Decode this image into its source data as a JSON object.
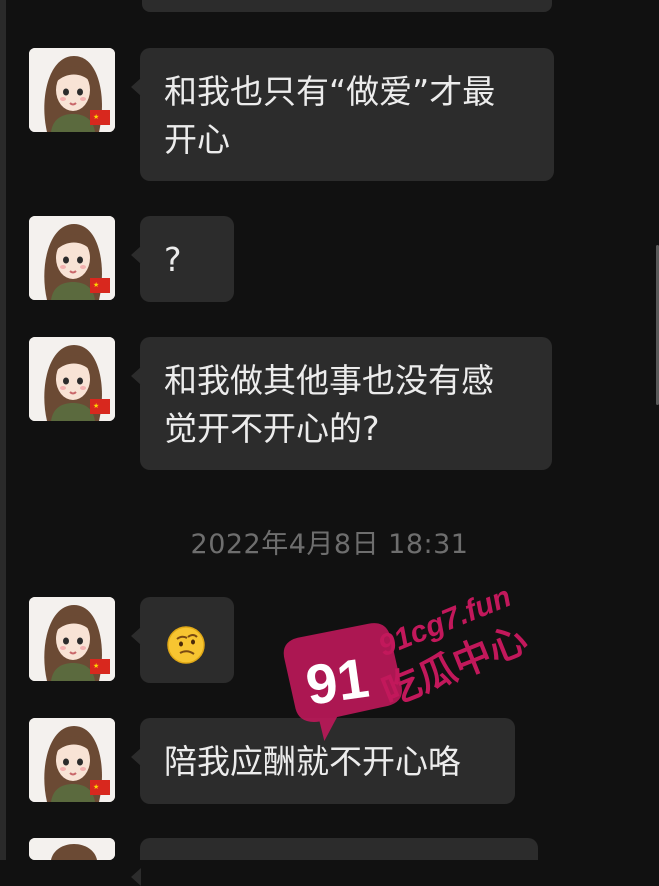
{
  "messages": [
    {
      "text": "和我也只有“做爱”才最开心",
      "line1": "和我也只有“做爱”才最",
      "line2": "开心"
    },
    {
      "text": "?"
    },
    {
      "text": "和我做其他事也没有感觉开不开心的?",
      "line1": "和我做其他事也没有感",
      "line2": "觉开不开心的?"
    },
    {
      "emoji": "confused-face-emoji"
    },
    {
      "text": "陪我应酬就不开心咯"
    }
  ],
  "timestamp": "2022年4月8日 18:31",
  "watermark": {
    "number": "91",
    "site": "91cg7.fun",
    "brand": "吃瓜中心",
    "color": "#c2185b"
  },
  "colors": {
    "background": "#111111",
    "bubble": "#2c2c2c",
    "text": "#ececec",
    "timestamp": "#6e6e6e"
  }
}
